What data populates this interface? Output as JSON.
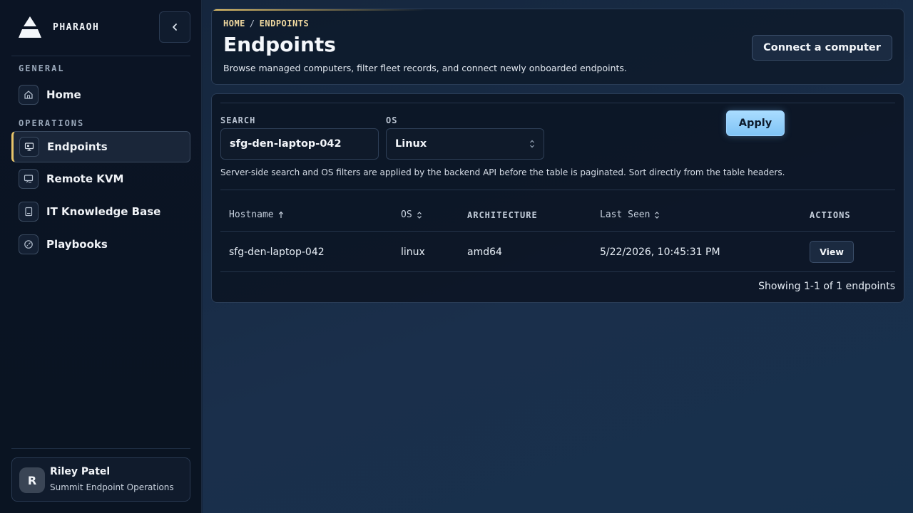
{
  "brand": {
    "name": "PHARAOH"
  },
  "sidebar": {
    "sections": [
      {
        "label": "GENERAL"
      },
      {
        "label": "OPERATIONS"
      }
    ],
    "items": [
      {
        "label": "Home",
        "icon": "home-icon"
      },
      {
        "label": "Endpoints",
        "icon": "monitor-icon",
        "active": true
      },
      {
        "label": "Remote KVM",
        "icon": "remote-screen-icon"
      },
      {
        "label": "IT Knowledge Base",
        "icon": "book-icon"
      },
      {
        "label": "Playbooks",
        "icon": "gauge-icon"
      }
    ],
    "user": {
      "initial": "R",
      "name": "Riley Patel",
      "org": "Summit Endpoint Operations"
    }
  },
  "header": {
    "breadcrumb": [
      "HOME",
      "ENDPOINTS"
    ],
    "title": "Endpoints",
    "subtitle": "Browse managed computers, filter fleet records, and connect newly onboarded endpoints.",
    "connect_label": "Connect a computer"
  },
  "filters": {
    "search_label": "SEARCH",
    "search_value": "sfg-den-laptop-042",
    "os_label": "OS",
    "os_value": "Linux",
    "apply_label": "Apply",
    "note": "Server-side search and OS filters are applied by the backend API before the table is paginated. Sort directly from the table headers."
  },
  "table": {
    "headers": {
      "hostname": "Hostname",
      "os": "OS",
      "architecture": "ARCHITECTURE",
      "last_seen": "Last Seen",
      "actions": "ACTIONS"
    },
    "rows": [
      {
        "hostname": "sfg-den-laptop-042",
        "os": "linux",
        "architecture": "amd64",
        "last_seen": "5/22/2026, 10:45:31 PM",
        "action": "View"
      }
    ],
    "pagination": "Showing 1-1 of 1 endpoints"
  },
  "colors": {
    "accent_gold": "#e8c56a",
    "primary_button": "#a9dcff",
    "background": "#14243a"
  }
}
